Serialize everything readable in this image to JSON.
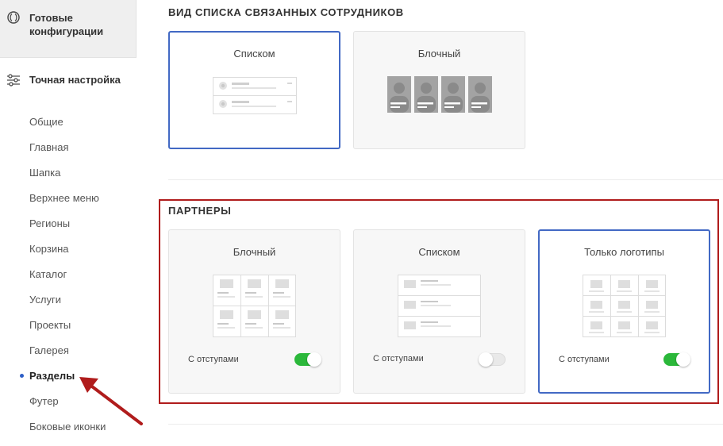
{
  "sidebar": {
    "preset_label": "Готовые конфигурации",
    "fine_label": "Точная настройка",
    "items": [
      {
        "label": "Общие"
      },
      {
        "label": "Главная"
      },
      {
        "label": "Шапка"
      },
      {
        "label": "Верхнее меню"
      },
      {
        "label": "Регионы"
      },
      {
        "label": "Корзина"
      },
      {
        "label": "Каталог"
      },
      {
        "label": "Услуги"
      },
      {
        "label": "Проекты"
      },
      {
        "label": "Галерея"
      },
      {
        "label": "Разделы",
        "active": true
      },
      {
        "label": "Футер"
      },
      {
        "label": "Боковые иконки"
      }
    ]
  },
  "employees": {
    "title": "ВИД СПИСКА СВЯЗАННЫХ СОТРУДНИКОВ",
    "options": [
      {
        "label": "Списком",
        "selected": true
      },
      {
        "label": "Блочный",
        "selected": false
      }
    ]
  },
  "partners": {
    "title": "ПАРТНЕРЫ",
    "options": [
      {
        "label": "Блочный",
        "selected": false,
        "toggle_label": "С отступами",
        "toggle_on": true
      },
      {
        "label": "Списком",
        "selected": false,
        "toggle_label": "С отступами",
        "toggle_on": false
      },
      {
        "label": "Только логотипы",
        "selected": true,
        "toggle_label": "С отступами",
        "toggle_on": true
      }
    ]
  },
  "colors": {
    "accent": "#4269c4",
    "toggle_on": "#2bb83a",
    "highlight": "#b01c1c"
  }
}
